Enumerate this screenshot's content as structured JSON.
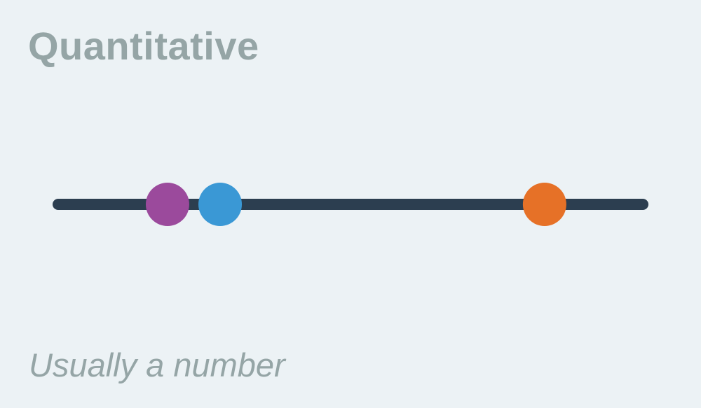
{
  "title": "Quantitative",
  "subtitle": "Usually a number",
  "colors": {
    "background": "#ecf2f5",
    "text": "#95a5a6",
    "line": "#2c3e50"
  },
  "scale": {
    "points": [
      {
        "name": "purple",
        "color": "#9b4a9c",
        "position": 0.187
      },
      {
        "name": "blue",
        "color": "#3a98d5",
        "position": 0.277
      },
      {
        "name": "orange",
        "color": "#e67127",
        "position": 0.832
      }
    ]
  }
}
